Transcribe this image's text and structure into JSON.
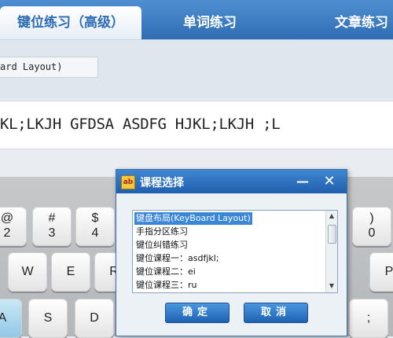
{
  "tabs": [
    {
      "label": "键位练习（高级）"
    },
    {
      "label": "单词练习"
    },
    {
      "label": "文章练习"
    }
  ],
  "course_label": "ard Layout)",
  "practice_text": "KL;LKJH GFDSA ASDFG HJKL;LKJH ;L",
  "keys": [
    {
      "top": "@",
      "bottom": "2"
    },
    {
      "top": "#",
      "bottom": "3"
    },
    {
      "top": "$",
      "bottom": "4"
    },
    {
      "top": ")",
      "bottom": "0"
    },
    {
      "top": "",
      "bottom": "W"
    },
    {
      "top": "",
      "bottom": "E"
    },
    {
      "top": "",
      "bottom": "R"
    },
    {
      "top": "",
      "bottom": "P"
    },
    {
      "top": "",
      "bottom": "A"
    },
    {
      "top": "",
      "bottom": "S"
    },
    {
      "top": "",
      "bottom": "D"
    },
    {
      "top": "",
      "bottom": ";"
    }
  ],
  "dialog": {
    "title": "课程选择",
    "items": [
      "键盘布局(KeyBoard Layout)",
      "手指分区练习",
      "键位纠错练习",
      "键位课程一：asdfjkl;",
      "键位课程二：ei",
      "键位课程三：ru"
    ],
    "ok_label": "确定",
    "cancel_label": "取消"
  },
  "colors": {
    "accent": "#2f6db4",
    "selection": "#3a86d9",
    "highlight_key": "#8fc7e6"
  }
}
